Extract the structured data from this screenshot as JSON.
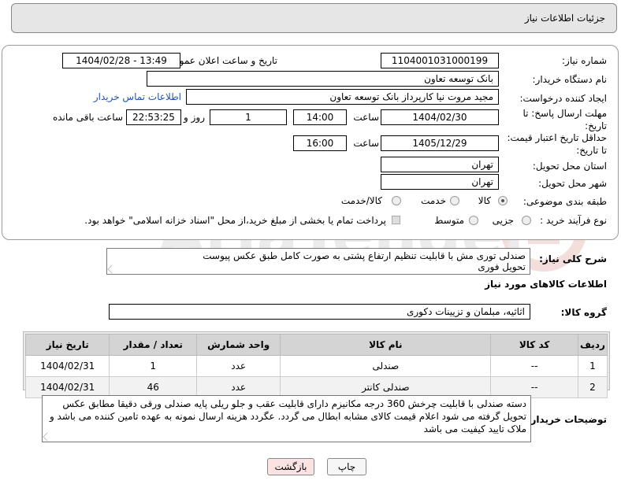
{
  "header": {
    "title": "جزئیات اطلاعات نیاز"
  },
  "fields": {
    "need_number": {
      "label": "شماره نیاز:",
      "value": "1104001031000199"
    },
    "announce": {
      "label": "تاریخ و ساعت اعلان عمومی:",
      "value": "1404/02/28 - 13:49"
    },
    "buyer_name": {
      "label": "نام دستگاه خریدار:",
      "value": "بانک توسعه تعاون"
    },
    "creator": {
      "label": "ایجاد کننده درخواست:",
      "value": "مجید مروت نیا کارپرداز بانک توسعه تعاون",
      "contact_link": "اطلاعات تماس خریدار"
    },
    "deadline": {
      "label_line1": "مهلت ارسال پاسخ: تا",
      "label_line2": "تاریخ:",
      "date": "1404/02/30",
      "time_label": "ساعت",
      "time": "14:00",
      "days": "1",
      "days_label": "روز و",
      "remaining": "22:53:25",
      "remaining_label": "ساعت باقی مانده"
    },
    "validity": {
      "label_line1": "حداقل تاریخ اعتبار قیمت:",
      "label_line2": "تا تاریخ:",
      "date": "1405/12/29",
      "time_label": "ساعت",
      "time": "16:00"
    },
    "province": {
      "label": "استان محل تحویل:",
      "value": "تهران"
    },
    "city": {
      "label": "شهر محل تحویل:",
      "value": "تهران"
    },
    "category": {
      "label": "طبقه بندی موضوعی:",
      "options": [
        "کالا",
        "خدمت",
        "کالا/خدمت"
      ]
    },
    "process": {
      "label": "نوع فرآیند خرید :",
      "options": [
        "جزیی",
        "متوسط"
      ],
      "payment_note": "پرداخت تمام یا بخشی از مبلغ خرید،از محل \"اسناد خزانه اسلامی\" خواهد بود."
    }
  },
  "description": {
    "label": "شرح کلی نیاز:",
    "line1": "صندلی توری مش با قابلیت تنظیم ارتفاع پشتی به صورت کامل طبق عکس پیوست",
    "line2": "تحویل فوری"
  },
  "goods_section": {
    "title": "اطلاعات کالاهای مورد نیاز",
    "group_label": "گروه کالا:",
    "group_value": "اثاثیه، مبلمان و تزیینات دکوری"
  },
  "table": {
    "headers": {
      "row": "ردیف",
      "code": "کد کالا",
      "name": "نام کالا",
      "unit": "واحد شمارش",
      "qty": "تعداد / مقدار",
      "date": "تاریخ نیاز"
    },
    "rows": [
      {
        "row": "1",
        "code": "--",
        "name": "صندلی",
        "unit": "عدد",
        "qty": "1",
        "date": "1404/02/31"
      },
      {
        "row": "2",
        "code": "--",
        "name": "صندلی کانتر",
        "unit": "عدد",
        "qty": "46",
        "date": "1404/02/31"
      }
    ]
  },
  "buyer_notes": {
    "label": "توضیحات خریدار:",
    "text": "دسته صندلی با قابلیت چرخش 360 درجه مکانیزم دارای قابلیت عقب و جلو ریلی پایه صندلی ورقی دقیقا مطابق عکس تحویل گرفته می شود اعلام قیمت کالای مشابه ابطال می گردد. عگردد هزینه ارسال نمونه به عهده تامین کننده می باشد و ملاک تایید کیفیت می باشد"
  },
  "buttons": {
    "print": "چاپ",
    "back": "بازگشت"
  },
  "colors": {
    "header_bg": "#e6e6e6",
    "link": "#2255aa",
    "back_button_bg": "#fbe3e3",
    "table_header_bg": "#d4d4d4"
  }
}
